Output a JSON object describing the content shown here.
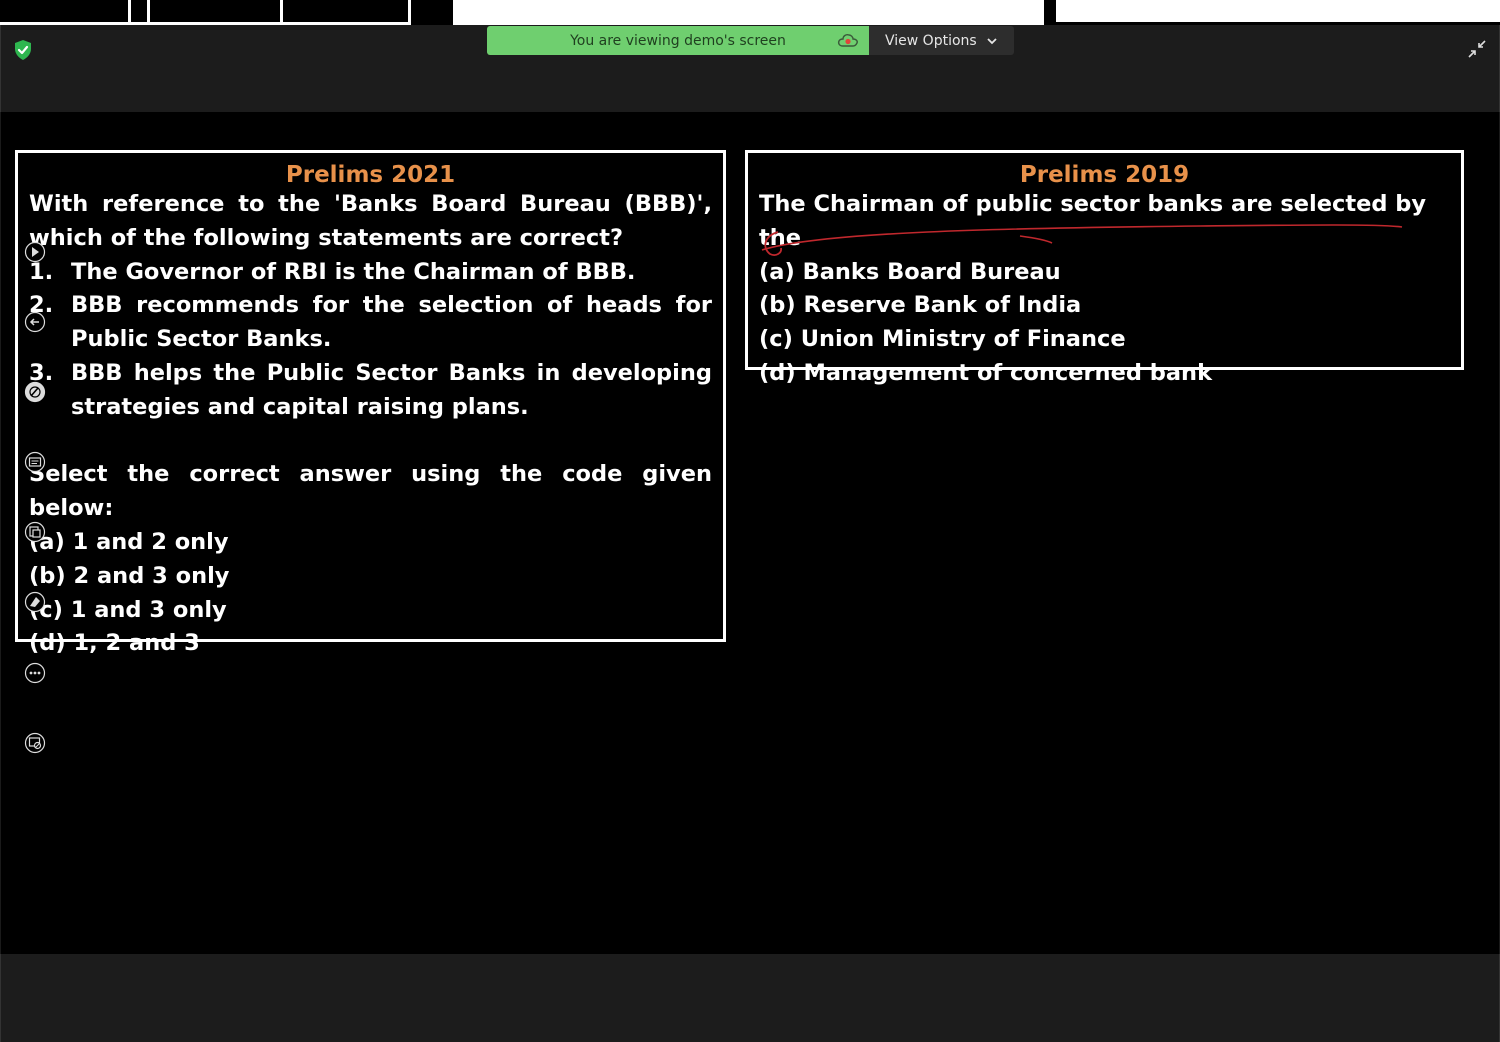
{
  "banner": {
    "viewing_text": "You are viewing demo's screen",
    "view_options_label": "View Options"
  },
  "left_question": {
    "title": "Prelims 2021",
    "intro": "With reference to the 'Banks Board Bureau (BBB)', which of the following statements are correct?",
    "statements": [
      {
        "num": "1.",
        "text": "The Governor of RBI is the Chairman of BBB."
      },
      {
        "num": "2.",
        "text": "BBB recommends for the selection of heads for Public Sector Banks."
      },
      {
        "num": "3.",
        "text": "BBB helps the Public Sector Banks in developing strategies and capital raising plans."
      }
    ],
    "instruction": "Select the correct answer using the code given below:",
    "options": [
      "(a) 1 and 2 only",
      "(b) 2 and 3 only",
      "(c) 1 and 3 only",
      "(d) 1, 2 and 3"
    ]
  },
  "right_question": {
    "title": "Prelims 2019",
    "intro": "The Chairman of public sector banks are selected by the",
    "options": [
      "(a) Banks Board Bureau",
      "(b) Reserve Bank of India",
      "(c) Union Ministry of Finance",
      "(d) Management of concerned bank"
    ]
  },
  "colors": {
    "title_orange": "#e8914a",
    "banner_green": "#6fcf6f",
    "annotation_red": "#c0282d",
    "shield_green": "#2eb64f"
  },
  "icons": [
    "shield-check-icon",
    "cloud-record-icon",
    "chevron-down-icon",
    "collapse-icon",
    "pointer-icon",
    "arrow-icon",
    "pen-icon",
    "text-icon",
    "stamp-icon",
    "eraser-icon",
    "more-icon",
    "save-icon"
  ]
}
